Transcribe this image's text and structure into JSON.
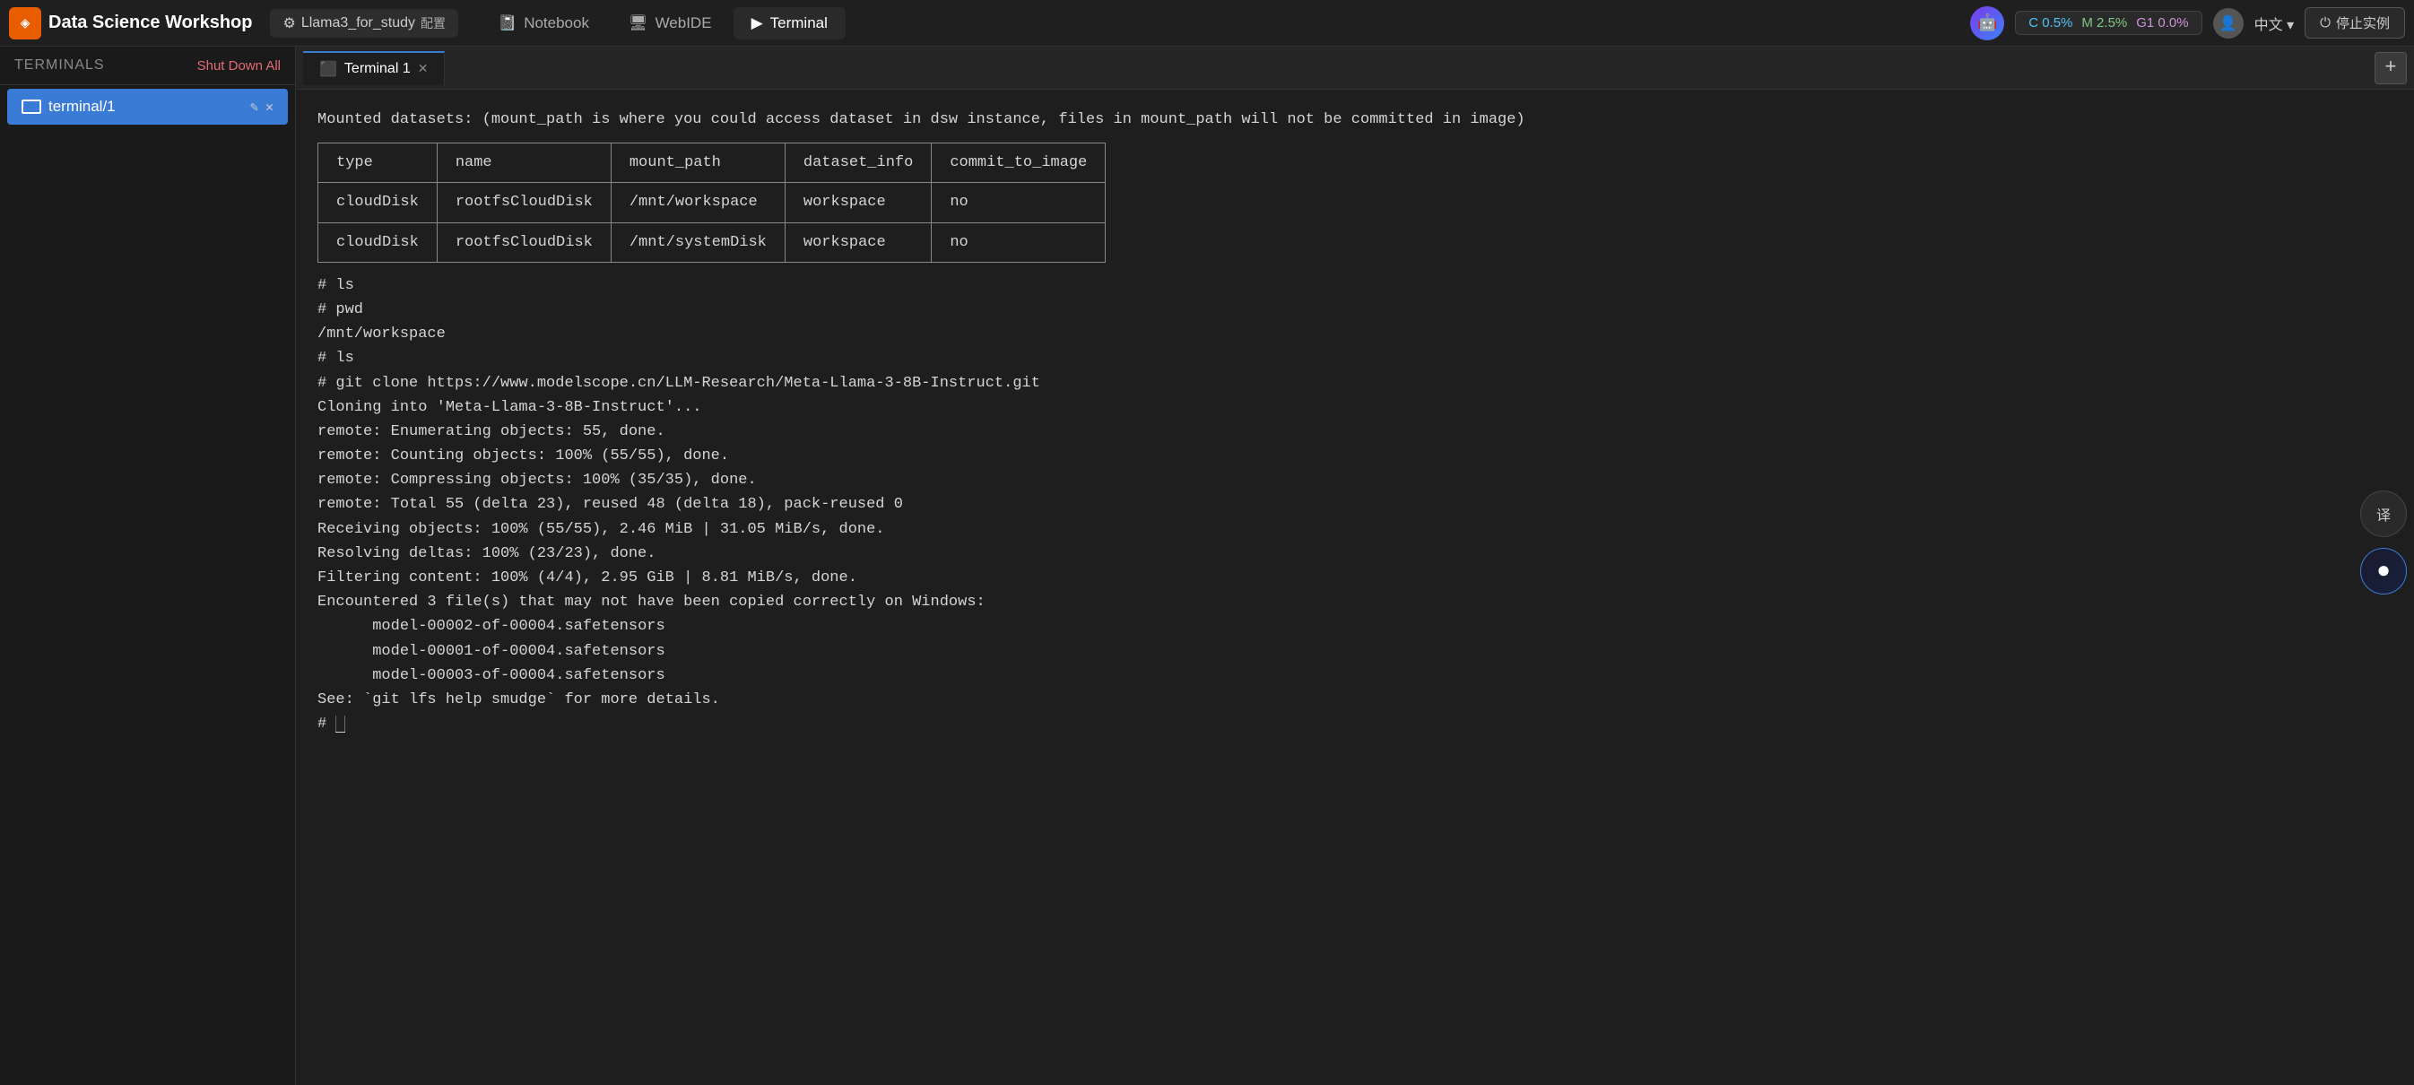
{
  "app": {
    "logo": "◈",
    "title": "Data Science Workshop"
  },
  "topbar": {
    "tab": {
      "icon": "⚙",
      "label": "Llama3_for_study",
      "config_label": "配置"
    },
    "nav_tabs": [
      {
        "id": "notebook",
        "icon": "📓",
        "label": "Notebook",
        "active": false
      },
      {
        "id": "webide",
        "icon": "🖥",
        "label": "WebIDE",
        "active": false
      },
      {
        "id": "terminal",
        "icon": "▶",
        "label": "Terminal",
        "active": true
      }
    ],
    "stats": {
      "c": "C 0.5%",
      "m": "M 2.5%",
      "g": "G1 0.0%"
    },
    "language": "中文 ▾",
    "stop_button": "停止实例"
  },
  "sidebar": {
    "title": "TERMINALS",
    "shutdown_all": "Shut Down All",
    "items": [
      {
        "label": "terminal/1"
      }
    ]
  },
  "terminal": {
    "tab_label": "Terminal 1",
    "add_button": "+",
    "content": {
      "intro_line": "Mounted datasets: (mount_path is where you could access dataset in dsw instance, files in mount_path will not be committed in image)",
      "table": {
        "headers": [
          "type",
          "name",
          "mount_path",
          "dataset_info",
          "commit_to_image"
        ],
        "rows": [
          [
            "cloudDisk",
            "rootfsCloudDisk",
            "/mnt/workspace",
            "workspace",
            "no"
          ],
          [
            "cloudDisk",
            "rootfsCloudDisk",
            "/mnt/systemDisk",
            "workspace",
            "no"
          ]
        ]
      },
      "commands": [
        {
          "type": "prompt",
          "text": "# ls"
        },
        {
          "type": "prompt",
          "text": "# pwd"
        },
        {
          "type": "output",
          "text": "/mnt/workspace"
        },
        {
          "type": "prompt",
          "text": "# ls"
        },
        {
          "type": "prompt",
          "text": "# git clone https://www.modelscope.cn/LLM-Research/Meta-Llama-3-8B-Instruct.git"
        },
        {
          "type": "output",
          "text": "Cloning into 'Meta-Llama-3-8B-Instruct'..."
        },
        {
          "type": "output",
          "text": "remote: Enumerating objects: 55, done."
        },
        {
          "type": "output",
          "text": "remote: Counting objects: 100% (55/55), done."
        },
        {
          "type": "output",
          "text": "remote: Compressing objects: 100% (35/35), done."
        },
        {
          "type": "output",
          "text": "remote: Total 55 (delta 23), reused 48 (delta 18), pack-reused 0"
        },
        {
          "type": "output",
          "text": "Receiving objects: 100% (55/55), 2.46 MiB | 31.05 MiB/s, done."
        },
        {
          "type": "output",
          "text": "Resolving deltas: 100% (23/23), done."
        },
        {
          "type": "output",
          "text": "Filtering content: 100% (4/4), 2.95 GiB | 8.81 MiB/s, done."
        },
        {
          "type": "output",
          "text": "Encountered 3 file(s) that may not have been copied correctly on Windows:"
        },
        {
          "type": "output",
          "text": "      model-00002-of-00004.safetensors"
        },
        {
          "type": "output",
          "text": "      model-00001-of-00004.safetensors"
        },
        {
          "type": "output",
          "text": "      model-00003-of-00004.safetensors"
        },
        {
          "type": "output",
          "text": ""
        },
        {
          "type": "output",
          "text": "See: `git lfs help smudge` for more details."
        },
        {
          "type": "prompt_cursor",
          "text": "# "
        }
      ]
    }
  },
  "floating": {
    "translate_icon": "译",
    "chat_icon": "●"
  }
}
